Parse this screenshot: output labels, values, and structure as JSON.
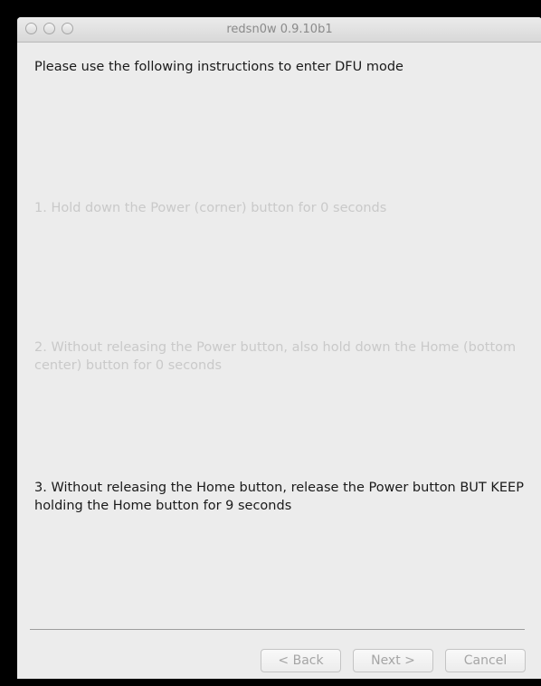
{
  "window": {
    "title": "redsn0w 0.9.10b1"
  },
  "content": {
    "heading": "Please use the following instructions to enter DFU mode",
    "steps": [
      {
        "text": "1. Hold down the Power (corner) button for 0 seconds",
        "state": "inactive"
      },
      {
        "text": "2. Without releasing the Power button, also hold down the Home (bottom center) button for 0 seconds",
        "state": "inactive"
      },
      {
        "text": "3. Without releasing the Home button, release the Power button BUT KEEP holding the Home button for 9 seconds",
        "state": "active"
      }
    ]
  },
  "footer": {
    "back_label": "< Back",
    "next_label": "Next >",
    "cancel_label": "Cancel"
  },
  "colors": {
    "window_bg": "#ececec",
    "inactive_text": "#c9c9c9",
    "active_text": "#1a1a1a"
  }
}
